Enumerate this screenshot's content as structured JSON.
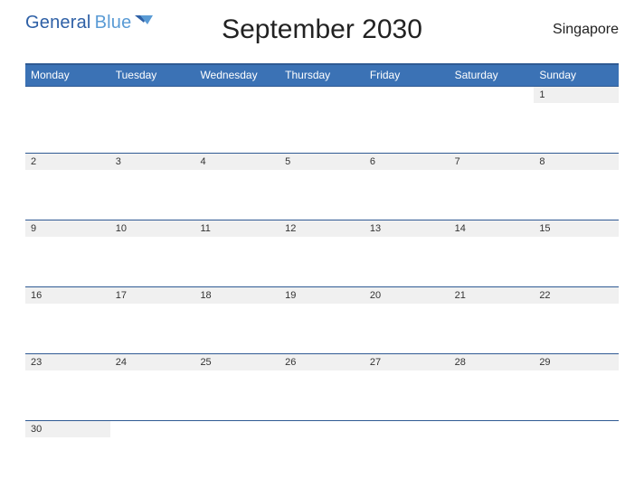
{
  "brand": {
    "word1": "General",
    "word2": "Blue"
  },
  "title": "September 2030",
  "locale": "Singapore",
  "dow": [
    "Monday",
    "Tuesday",
    "Wednesday",
    "Thursday",
    "Friday",
    "Saturday",
    "Sunday"
  ],
  "weeks": [
    {
      "days": [
        "",
        "",
        "",
        "",
        "",
        "",
        "1"
      ]
    },
    {
      "days": [
        "2",
        "3",
        "4",
        "5",
        "6",
        "7",
        "8"
      ]
    },
    {
      "days": [
        "9",
        "10",
        "11",
        "12",
        "13",
        "14",
        "15"
      ]
    },
    {
      "days": [
        "16",
        "17",
        "18",
        "19",
        "20",
        "21",
        "22"
      ]
    },
    {
      "days": [
        "23",
        "24",
        "25",
        "26",
        "27",
        "28",
        "29"
      ]
    },
    {
      "days": [
        "30",
        "",
        "",
        "",
        "",
        "",
        ""
      ]
    }
  ]
}
